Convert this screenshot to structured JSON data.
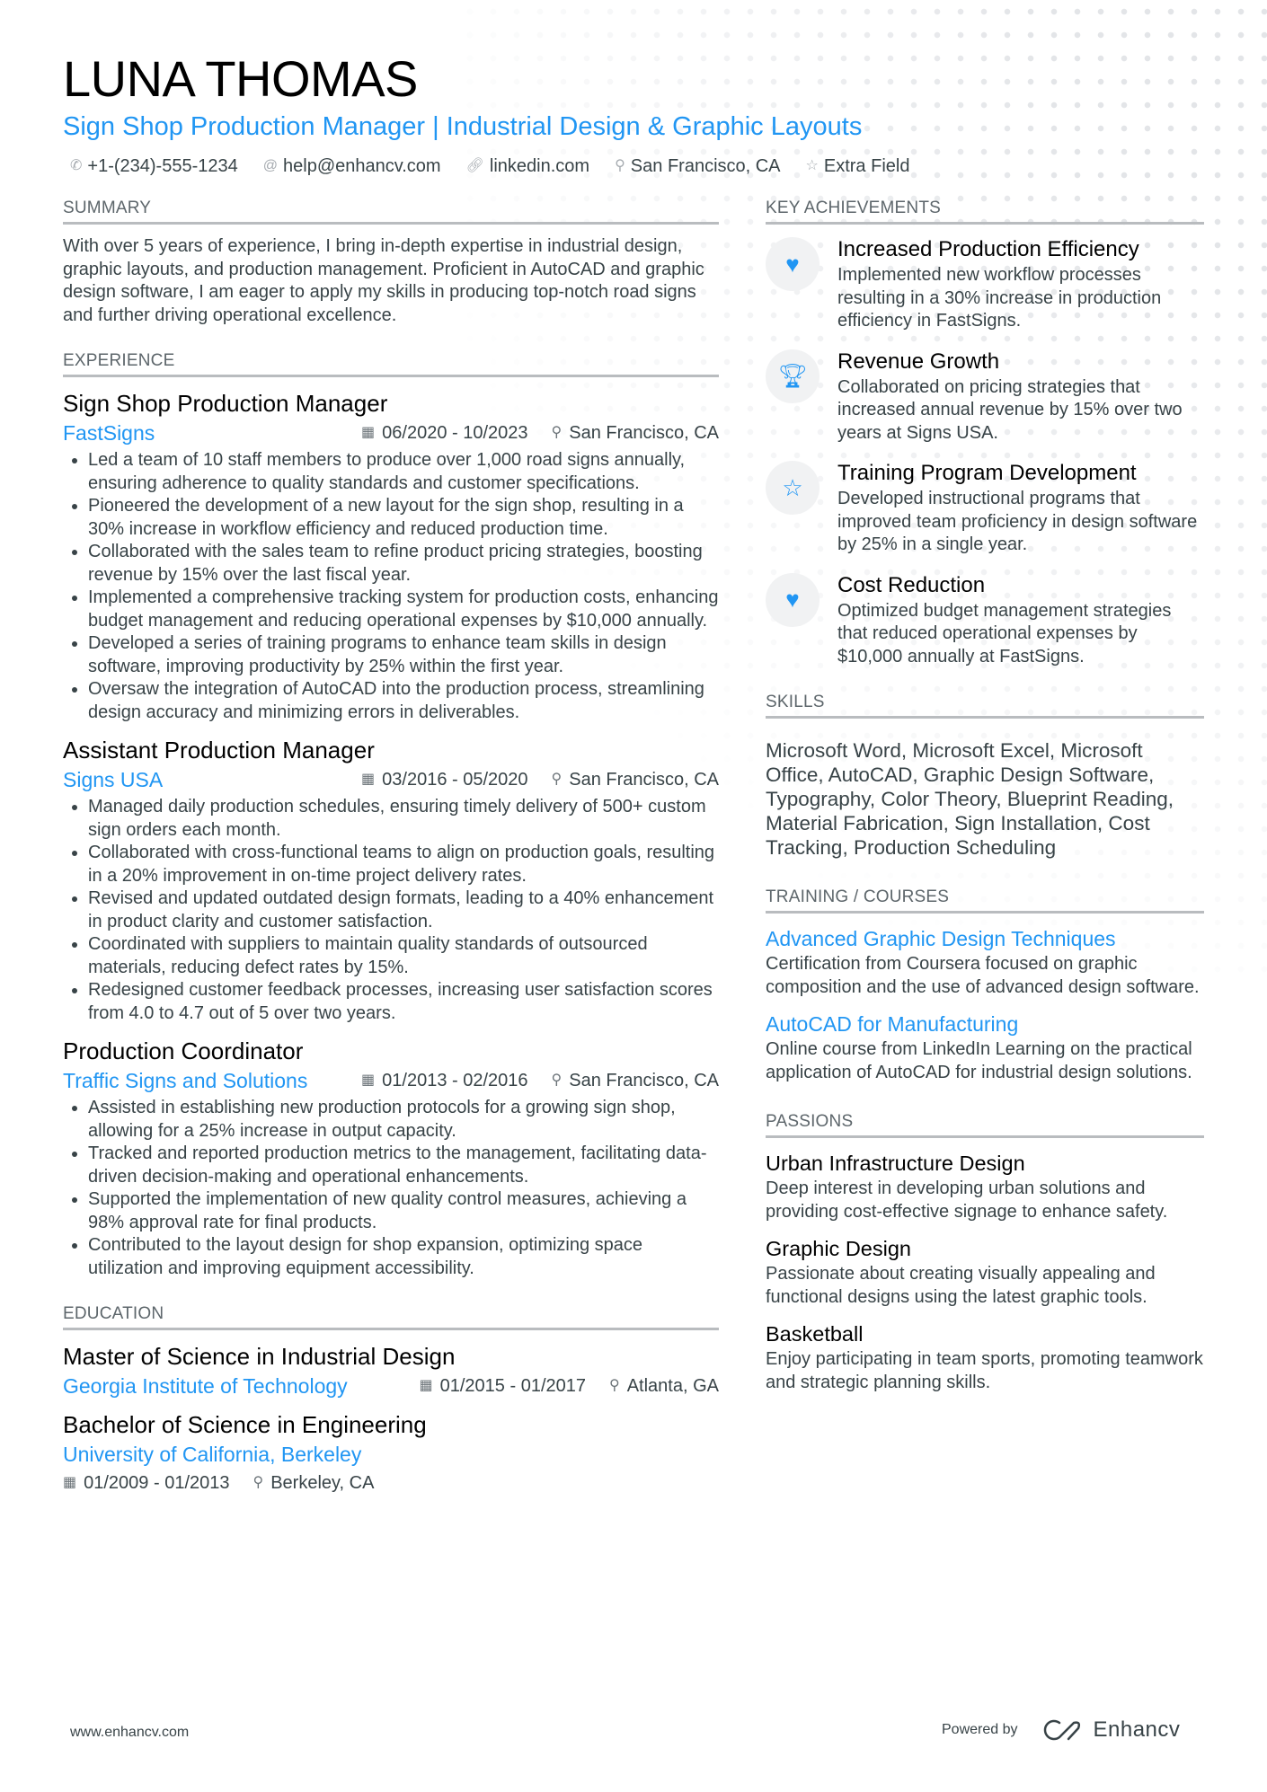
{
  "header": {
    "name": "LUNA THOMAS",
    "headline": "Sign Shop Production Manager | Industrial Design & Graphic Layouts",
    "contacts": [
      {
        "icon": "phone-icon",
        "glyph": "✆",
        "text": "+1-(234)-555-1234"
      },
      {
        "icon": "at-icon",
        "glyph": "@",
        "text": "help@enhancv.com"
      },
      {
        "icon": "link-icon",
        "glyph": "🔗︎",
        "text": "linkedin.com"
      },
      {
        "icon": "location-pin-icon",
        "glyph": "⚲",
        "text": "San Francisco, CA"
      },
      {
        "icon": "star-icon",
        "glyph": "☆",
        "text": "Extra Field"
      }
    ]
  },
  "summary": {
    "heading": "SUMMARY",
    "text": "With over 5 years of experience, I bring in-depth expertise in industrial design, graphic layouts, and production management. Proficient in AutoCAD and graphic design software, I am eager to apply my skills in producing top-notch road signs and further driving operational excellence."
  },
  "experience": {
    "heading": "EXPERIENCE",
    "jobs": [
      {
        "title": "Sign Shop Production Manager",
        "company": "FastSigns",
        "dates": "06/2020 - 10/2023",
        "location": "San Francisco, CA",
        "bullets": [
          "Led a team of 10 staff members to produce over 1,000 road signs annually, ensuring adherence to quality standards and customer specifications.",
          "Pioneered the development of a new layout for the sign shop, resulting in a 30% increase in workflow efficiency and reduced production time.",
          "Collaborated with the sales team to refine product pricing strategies, boosting revenue by 15% over the last fiscal year.",
          "Implemented a comprehensive tracking system for production costs, enhancing budget management and reducing operational expenses by $10,000 annually.",
          "Developed a series of training programs to enhance team skills in design software, improving productivity by 25% within the first year.",
          "Oversaw the integration of AutoCAD into the production process, streamlining design accuracy and minimizing errors in deliverables."
        ]
      },
      {
        "title": "Assistant Production Manager",
        "company": "Signs USA",
        "dates": "03/2016 - 05/2020",
        "location": "San Francisco, CA",
        "bullets": [
          "Managed daily production schedules, ensuring timely delivery of 500+ custom sign orders each month.",
          "Collaborated with cross-functional teams to align on production goals, resulting in a 20% improvement in on-time project delivery rates.",
          "Revised and updated outdated design formats, leading to a 40% enhancement in product clarity and customer satisfaction.",
          "Coordinated with suppliers to maintain quality standards of outsourced materials, reducing defect rates by 15%.",
          "Redesigned customer feedback processes, increasing user satisfaction scores from 4.0 to 4.7 out of 5 over two years."
        ]
      },
      {
        "title": "Production Coordinator",
        "company": "Traffic Signs and Solutions",
        "dates": "01/2013 - 02/2016",
        "location": "San Francisco, CA",
        "bullets": [
          "Assisted in establishing new production protocols for a growing sign shop, allowing for a 25% increase in output capacity.",
          "Tracked and reported production metrics to the management, facilitating data-driven decision-making and operational enhancements.",
          "Supported the implementation of new quality control measures, achieving a 98% approval rate for final products.",
          "Contributed to the layout design for shop expansion, optimizing space utilization and improving equipment accessibility."
        ]
      }
    ]
  },
  "education": {
    "heading": "EDUCATION",
    "items": [
      {
        "degree": "Master of Science in Industrial Design",
        "school": "Georgia Institute of Technology",
        "dates": "01/2015 - 01/2017",
        "location": "Atlanta, GA"
      },
      {
        "degree": "Bachelor of Science in Engineering",
        "school": "University of California, Berkeley",
        "dates": "01/2009 - 01/2013",
        "location": "Berkeley, CA"
      }
    ]
  },
  "achievements": {
    "heading": "KEY ACHIEVEMENTS",
    "items": [
      {
        "icon": "heart-icon",
        "glyph": "♥",
        "title": "Increased Production Efficiency",
        "desc": "Implemented new workflow processes resulting in a 30% increase in production efficiency in FastSigns."
      },
      {
        "icon": "trophy-icon",
        "glyph": "🏆︎",
        "title": "Revenue Growth",
        "desc": "Collaborated on pricing strategies that increased annual revenue by 15% over two years at Signs USA."
      },
      {
        "icon": "star-outline-icon",
        "glyph": "☆",
        "title": "Training Program Development",
        "desc": "Developed instructional programs that improved team proficiency in design software by 25% in a single year."
      },
      {
        "icon": "heart-icon",
        "glyph": "♥",
        "title": "Cost Reduction",
        "desc": "Optimized budget management strategies that reduced operational expenses by $10,000 annually at FastSigns."
      }
    ]
  },
  "skills": {
    "heading": "SKILLS",
    "text": "Microsoft Word, Microsoft Excel, Microsoft Office, AutoCAD, Graphic Design Software, Typography, Color Theory, Blueprint Reading, Material Fabrication, Sign Installation, Cost Tracking, Production Scheduling"
  },
  "training": {
    "heading": "TRAINING / COURSES",
    "items": [
      {
        "title": "Advanced Graphic Design Techniques",
        "desc": "Certification from Coursera focused on graphic composition and the use of advanced design software."
      },
      {
        "title": "AutoCAD for Manufacturing",
        "desc": "Online course from LinkedIn Learning on the practical application of AutoCAD for industrial design solutions."
      }
    ]
  },
  "passions": {
    "heading": "PASSIONS",
    "items": [
      {
        "title": "Urban Infrastructure Design",
        "desc": "Deep interest in developing urban solutions and providing cost-effective signage to enhance safety."
      },
      {
        "title": "Graphic Design",
        "desc": "Passionate about creating visually appealing and functional designs using the latest graphic tools."
      },
      {
        "title": "Basketball",
        "desc": "Enjoy participating in team sports, promoting teamwork and strategic planning skills."
      }
    ]
  },
  "footer": {
    "website": "www.enhancv.com",
    "powered_by": "Powered by",
    "brand": "Enhancv"
  },
  "icons": {
    "calendar": "▦",
    "location": "⚲"
  },
  "colors": {
    "accent": "#2196f3",
    "text": "#384347",
    "heading": "#000000",
    "rule": "#b9bcbf"
  }
}
